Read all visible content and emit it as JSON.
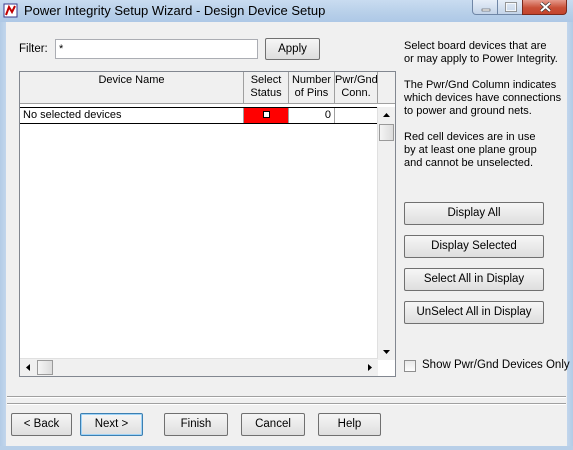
{
  "window": {
    "title": "Power Integrity Setup Wizard - Design Device Setup"
  },
  "filter": {
    "label": "Filter:",
    "value": "*",
    "apply_label": "Apply"
  },
  "table": {
    "columns": {
      "device_name": "Device Name",
      "select_status": [
        "Select",
        "Status"
      ],
      "number_of_pins": [
        "Number",
        "of Pins"
      ],
      "pwr_gnd_conn": [
        "Pwr/Gnd",
        "Conn."
      ]
    },
    "rows": [
      {
        "device_name": "No selected devices",
        "select_status_color": "#ff0000",
        "number_of_pins": "0",
        "pwr_gnd_conn": ""
      }
    ]
  },
  "info": {
    "para1": [
      "Select board devices that are",
      "or may apply to Power Integrity."
    ],
    "para2": [
      "The Pwr/Gnd Column indicates",
      "which devices have connections",
      "to power and ground nets."
    ],
    "para3": [
      "Red cell devices are in use",
      "by at least one plane group",
      "and cannot be unselected."
    ]
  },
  "actions": {
    "display_all": "Display All",
    "display_selected": "Display Selected",
    "select_all_in_display": "Select All in Display",
    "unselect_all_in_display": "UnSelect All in Display"
  },
  "options": {
    "show_pwr_gnd_only": "Show Pwr/Gnd Devices Only",
    "show_pwr_gnd_only_checked": false
  },
  "footer": {
    "back": "< Back",
    "next": "Next >",
    "finish": "Finish",
    "cancel": "Cancel",
    "help": "Help"
  },
  "colors": {
    "titlebar": "#b7cfe9",
    "close_button": "#c95038",
    "red_cell": "#ff0000",
    "dialog_bg": "#f0f0f0"
  }
}
